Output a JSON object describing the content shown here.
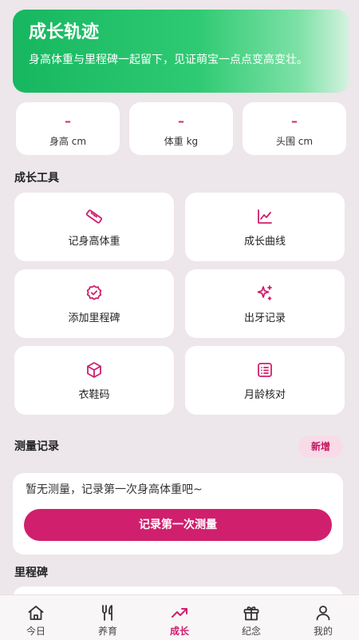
{
  "header": {
    "title": "成长轨迹",
    "subtitle": "身高体重与里程碑一起留下，见证萌宝一点点变高变壮。"
  },
  "stats": [
    {
      "value": "–",
      "label": "身高 cm"
    },
    {
      "value": "–",
      "label": "体重 kg"
    },
    {
      "value": "–",
      "label": "头围 cm"
    }
  ],
  "tools_section": {
    "title": "成长工具"
  },
  "tools": [
    {
      "label": "记身高体重",
      "icon": "ruler-icon"
    },
    {
      "label": "成长曲线",
      "icon": "chart-line-icon"
    },
    {
      "label": "添加里程碑",
      "icon": "badge-check-icon"
    },
    {
      "label": "出牙记录",
      "icon": "sparkle-icon"
    },
    {
      "label": "衣鞋码",
      "icon": "box-icon"
    },
    {
      "label": "月龄核对",
      "icon": "calendar-list-icon"
    }
  ],
  "records": {
    "title": "测量记录",
    "add_label": "新增",
    "empty_text": "暂无测量，记录第一次身高体重吧~",
    "cta_label": "记录第一次测量"
  },
  "milestones": {
    "title": "里程碑"
  },
  "tabbar": {
    "items": [
      {
        "label": "今日",
        "icon": "home-icon",
        "active": false
      },
      {
        "label": "养育",
        "icon": "utensils-icon",
        "active": false
      },
      {
        "label": "成长",
        "icon": "trend-up-icon",
        "active": true
      },
      {
        "label": "纪念",
        "icon": "gift-icon",
        "active": false
      },
      {
        "label": "我的",
        "icon": "user-icon",
        "active": false
      }
    ]
  },
  "colors": {
    "accent": "#d01f6d",
    "hero_gradient_start": "#16b760",
    "background": "#ede6ea"
  }
}
